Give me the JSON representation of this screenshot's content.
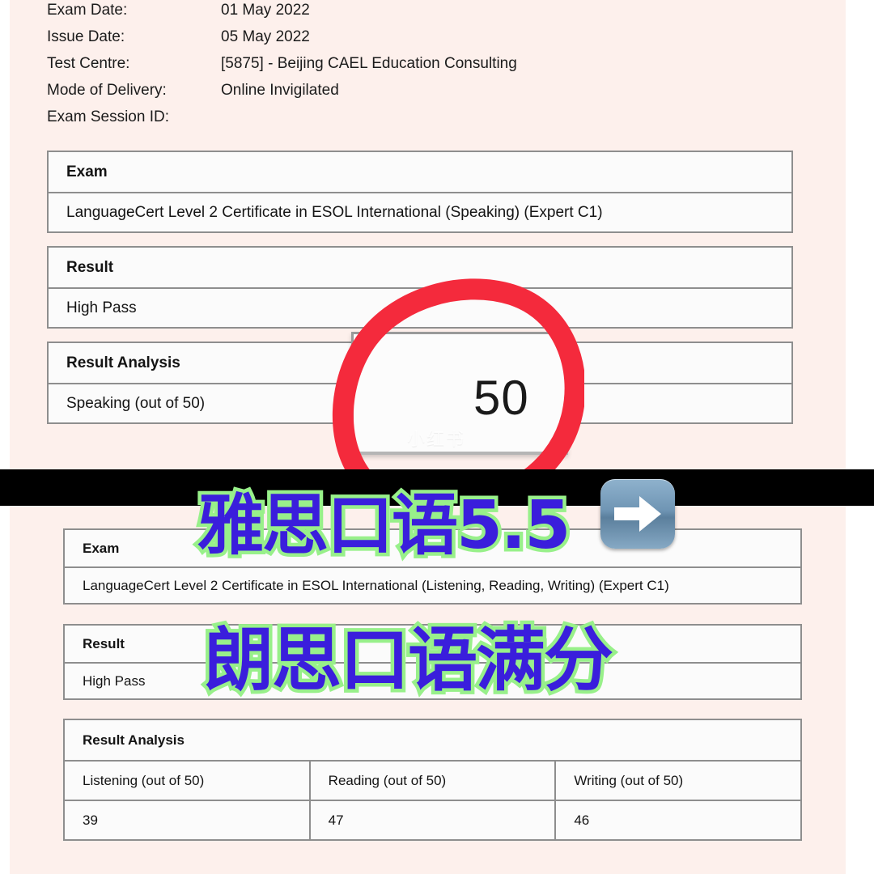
{
  "colors": {
    "sheet_background": "#fdf0ec",
    "band": "#000000",
    "highlight_circle": "#f42a3c",
    "caption_fill": "#3a1edc",
    "caption_stroke": "#98f08a",
    "arrow_button": "#6f95b4",
    "table_border": "#8e8e8e"
  },
  "top_certificate": {
    "meta": [
      {
        "label": "Exam Date:",
        "value": "01 May 2022"
      },
      {
        "label": "Issue Date:",
        "value": "05 May 2022"
      },
      {
        "label": "Test Centre:",
        "value": "[5875] - Beijing CAEL Education Consulting"
      },
      {
        "label": "Mode of Delivery:",
        "value": "Online Invigilated"
      },
      {
        "label": "Exam Session ID:",
        "value": ""
      }
    ],
    "exam_table": {
      "header": "Exam",
      "value": "LanguageCert Level 2 Certificate in ESOL International (Speaking) (Expert C1)"
    },
    "result_table": {
      "header": "Result",
      "value": "High Pass"
    },
    "analysis_table": {
      "header": "Result Analysis",
      "columns": [
        "Speaking (out of 50)"
      ],
      "values": [
        "50"
      ]
    },
    "score_inset": {
      "value": "50",
      "watermark": "小红书"
    }
  },
  "bottom_certificate": {
    "exam_table": {
      "header": "Exam",
      "value": "LanguageCert Level 2 Certificate in ESOL International (Listening, Reading, Writing) (Expert C1)"
    },
    "result_table": {
      "header": "Result",
      "value": "High Pass"
    },
    "analysis_table": {
      "header": "Result Analysis",
      "columns": [
        "Listening (out of 50)",
        "Reading (out of 50)",
        "Writing (out of 50)"
      ],
      "values": [
        "39",
        "47",
        "46"
      ]
    }
  },
  "overlay": {
    "caption_line1": "雅思口语5.5",
    "caption_line2": "朗思口语满分",
    "next_arrow_label": "→"
  }
}
